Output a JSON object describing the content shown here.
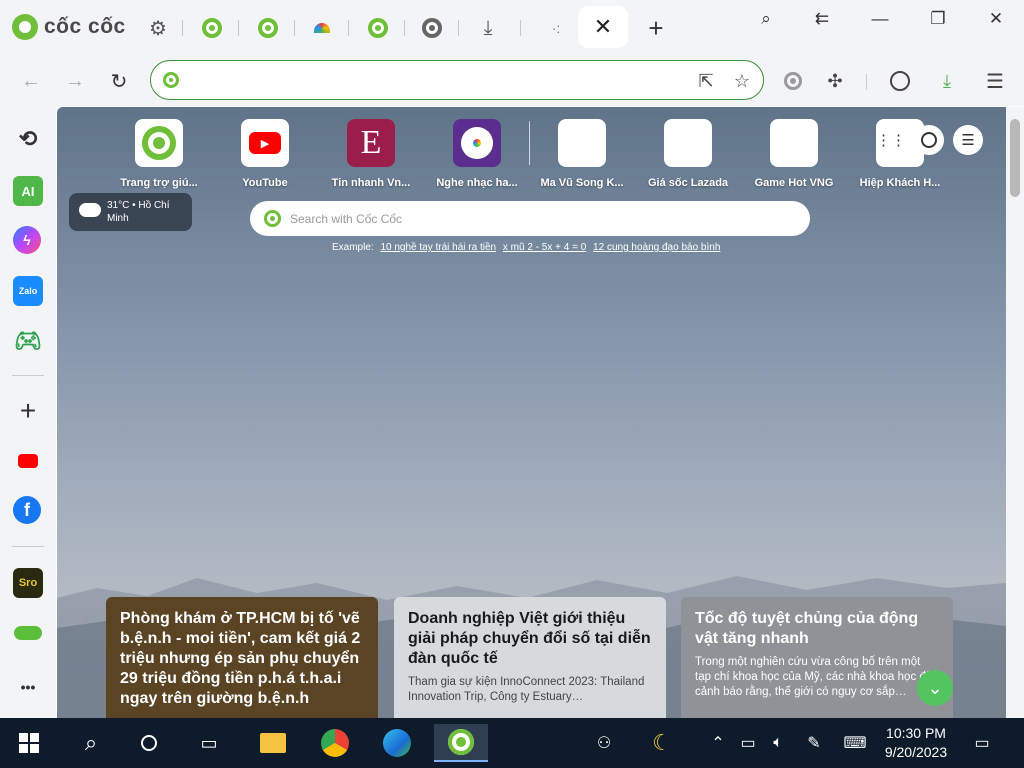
{
  "titlebar": {
    "brand": "cốc cốc",
    "active_tab_close": "✕",
    "new_tab": "+"
  },
  "toolbar": {
    "address_value": "",
    "address_placeholder": ""
  },
  "speed_dial": [
    {
      "label": "Trang trợ giú...",
      "icon": "coccoc-icon"
    },
    {
      "label": "YouTube",
      "icon": "youtube-icon"
    },
    {
      "label": "Tin nhanh Vn...",
      "icon": "vnexpress-icon",
      "glyph": "E"
    },
    {
      "label": "Nghe nhạc ha...",
      "icon": "music-icon"
    },
    {
      "label": "Ma Vũ Song K...",
      "icon": "broken-image-icon"
    },
    {
      "label": "Giá sốc Lazada",
      "icon": "broken-image-icon"
    },
    {
      "label": "Game Hot VNG",
      "icon": "broken-image-icon"
    },
    {
      "label": "Hiệp Khách H...",
      "icon": "broken-image-icon"
    }
  ],
  "weather": {
    "line1": "31°C • Hồ Chí",
    "line2": "Minh"
  },
  "search": {
    "placeholder": "Search with Cốc Cốc",
    "examples_label": "Example:",
    "examples": [
      "10 nghề tay trái hái ra tiền",
      "x mũ 2 - 5x + 4 = 0",
      "12 cung hoàng đạo bảo bình"
    ]
  },
  "news": [
    {
      "title": "Phòng khám ở TP.HCM bị tố 'vẽ b.ệ.n.h - moi tiền', cam kết giá 2 triệu nhưng ép sản phụ chuyển 29 triệu đồng tiền p.h.á t.h.a.i ngay trên giường b.ệ.n.h",
      "summary": "",
      "bg": "#5a4424",
      "fg": "#ffffff"
    },
    {
      "title": "Doanh nghiệp Việt giới thiệu giải pháp chuyển đổi số tại diễn đàn quốc tế",
      "summary": "Tham gia sự kiện InnoConnect 2023: Thailand Innovation Trip, Công ty Estuary…",
      "bg": "#d7dadd",
      "fg": "#1a1a1a"
    },
    {
      "title": "Tốc độ tuyệt chủng của động vật tăng nhanh",
      "summary": "Trong một nghiên cứu vừa công bố trên một tạp chí khoa học của Mỹ, các nhà khoa học đã cảnh báo rằng, thế giới có nguy cơ sắp…",
      "bg": "#8f9397",
      "fg": "#ffffff"
    }
  ],
  "sidebar": {
    "ai_label": "AI",
    "zalo_label": "Zalo",
    "add_label": "+",
    "more_label": "•••",
    "sro_label": "Sro"
  },
  "taskbar": {
    "time": "10:30 PM",
    "date": "9/20/2023"
  },
  "colors": {
    "accent": "#6fbf3a",
    "omnibox_border": "#3d8f3d",
    "taskbar": "#0d1b2a"
  }
}
